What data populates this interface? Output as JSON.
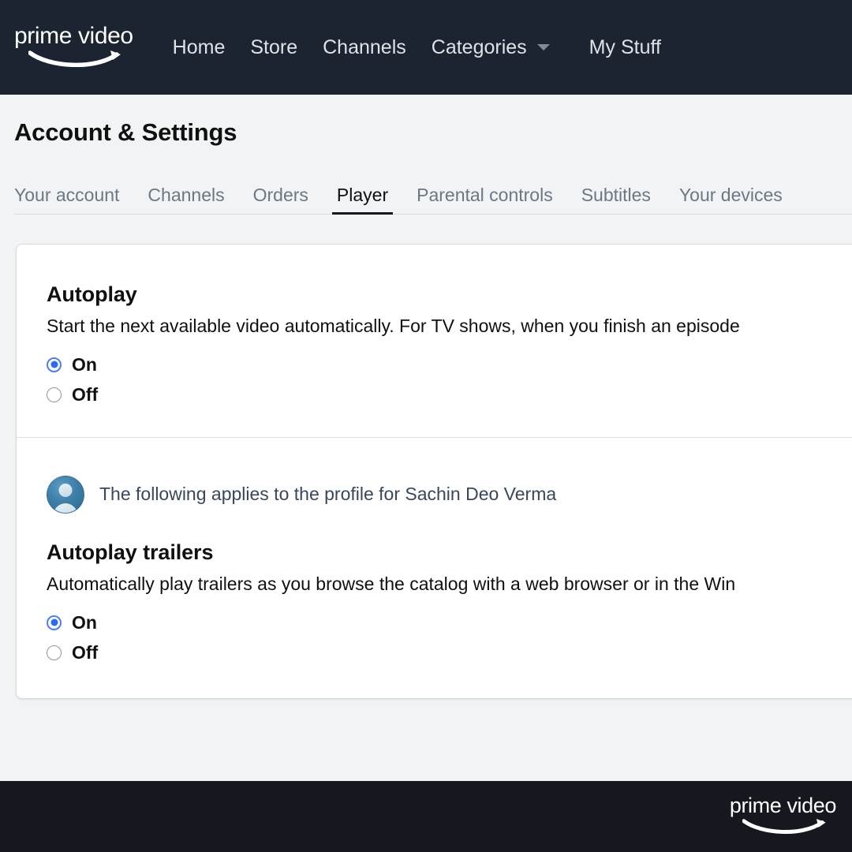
{
  "nav": {
    "logo_text": "prime video",
    "logo_icon": "amazon-smile-icon",
    "links": [
      {
        "label": "Home",
        "caret": false
      },
      {
        "label": "Store",
        "caret": false
      },
      {
        "label": "Channels",
        "caret": false
      },
      {
        "label": "Categories",
        "caret": true
      },
      {
        "label": "My Stuff",
        "caret": false
      }
    ],
    "caret_icon": "chevron-down-icon"
  },
  "header": {
    "title": "Account & Settings"
  },
  "tabs": [
    {
      "label": "Your account",
      "active": false
    },
    {
      "label": "Channels",
      "active": false
    },
    {
      "label": "Orders",
      "active": false
    },
    {
      "label": "Player",
      "active": true
    },
    {
      "label": "Parental controls",
      "active": false
    },
    {
      "label": "Subtitles",
      "active": false
    },
    {
      "label": "Your devices",
      "active": false
    }
  ],
  "autoplay": {
    "title": "Autoplay",
    "description": "Start the next available video automatically. For TV shows, when you finish an episode",
    "options": [
      {
        "label": "On",
        "selected": true
      },
      {
        "label": "Off",
        "selected": false
      }
    ]
  },
  "profile": {
    "avatar_icon": "user-avatar-icon",
    "notice": "The following applies to the profile for Sachin Deo Verma",
    "name": "Sachin Deo Verma"
  },
  "autoplay_trailers": {
    "title": "Autoplay trailers",
    "description": "Automatically play trailers as you browse the catalog with a web browser or in the Win",
    "options": [
      {
        "label": "On",
        "selected": true
      },
      {
        "label": "Off",
        "selected": false
      }
    ]
  },
  "footer": {
    "logo_text": "prime video",
    "logo_icon": "amazon-smile-icon"
  },
  "colors": {
    "nav_background": "#1b2430",
    "page_background": "#f2f3f5",
    "card_background": "#ffffff",
    "accent_radio": "#2a6cf0",
    "tab_active_underline": "#111820",
    "footer_background": "#15191f",
    "profile_text": "#39475a"
  }
}
